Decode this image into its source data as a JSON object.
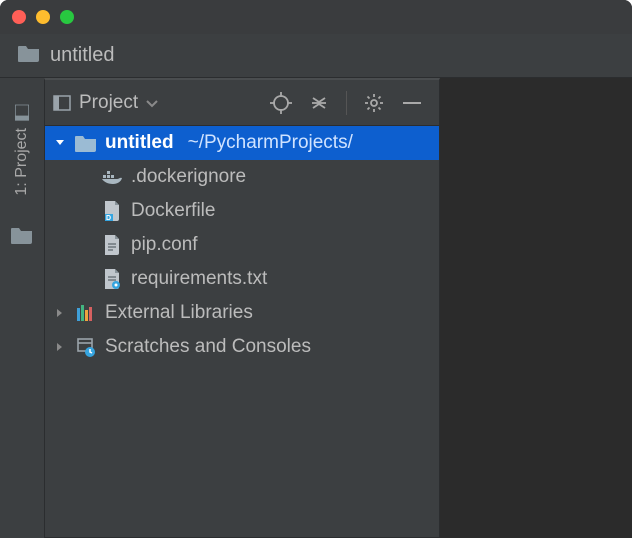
{
  "breadcrumb": {
    "name": "untitled"
  },
  "side_tool": {
    "label": "1: Project"
  },
  "panel": {
    "title": "Project"
  },
  "tree": {
    "root": {
      "name": "untitled",
      "path": "~/PycharmProjects/",
      "files": [
        {
          "name": ".dockerignore"
        },
        {
          "name": "Dockerfile"
        },
        {
          "name": "pip.conf"
        },
        {
          "name": "requirements.txt"
        }
      ]
    },
    "extra": [
      {
        "name": "External Libraries"
      },
      {
        "name": "Scratches and Consoles"
      }
    ]
  }
}
